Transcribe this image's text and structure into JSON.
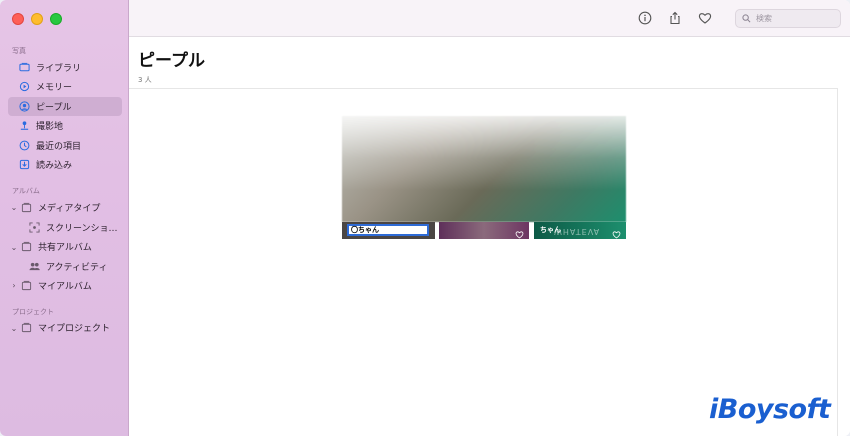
{
  "sidebar": {
    "section_photos": "写真",
    "items_photos": [
      {
        "label": "ライブラリ",
        "icon": "library-icon"
      },
      {
        "label": "メモリー",
        "icon": "memories-icon"
      },
      {
        "label": "ピープル",
        "icon": "people-icon",
        "active": true
      },
      {
        "label": "撮影地",
        "icon": "places-icon"
      },
      {
        "label": "最近の項目",
        "icon": "recents-icon"
      },
      {
        "label": "読み込み",
        "icon": "imports-icon"
      }
    ],
    "section_albums": "アルバム",
    "media_types": "メディアタイプ",
    "screenshots": "スクリーンショ…",
    "shared_albums": "共有アルバム",
    "activity": "アクティビティ",
    "my_albums": "マイアルバム",
    "section_projects": "プロジェクト",
    "my_projects": "マイプロジェクト"
  },
  "toolbar": {
    "search_placeholder": "検索"
  },
  "main": {
    "title": "ピープル",
    "count": "3 人",
    "faces": [
      {
        "name_editing": "〇ちゃん"
      },
      {
        "name": ""
      },
      {
        "name": "ちゃん"
      }
    ],
    "watermark_text": "WHATEVA"
  },
  "brand": {
    "logo": "iBoysoft",
    "accent": "#2e6bd6",
    "logo_color": "#1a5fd0"
  }
}
